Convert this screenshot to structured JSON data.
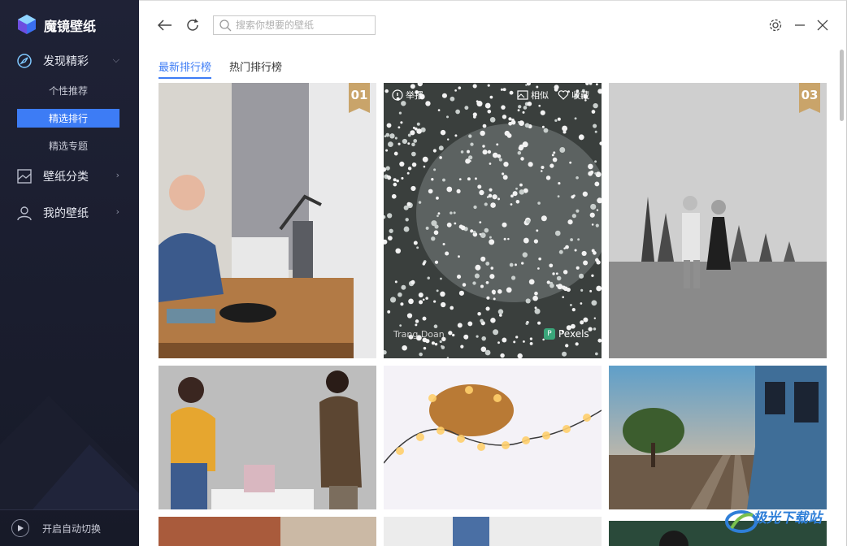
{
  "app": {
    "title": "魔镜壁纸"
  },
  "sidebar": {
    "discover": {
      "label": "发现精彩"
    },
    "sub": {
      "recommend": "个性推荐",
      "ranking": "精选排行",
      "topics": "精选专题"
    },
    "categories": {
      "label": "壁纸分类"
    },
    "mine": {
      "label": "我的壁纸"
    },
    "auto_switch": "开启自动切换"
  },
  "search": {
    "placeholder": "搜索你想要的壁纸"
  },
  "tabs": {
    "latest": "最新排行榜",
    "hot": "热门排行榜"
  },
  "cards": {
    "c1": {
      "rank": "01"
    },
    "c2": {
      "report": "举报",
      "similar": "相似",
      "favorite": "收藏",
      "author": "Trang Doan",
      "source": "Pexels"
    },
    "c3": {
      "rank": "03"
    }
  },
  "watermark": {
    "text": "极光下载站"
  },
  "colors": {
    "accent": "#3d7cf5",
    "rank_badge": "#c9a46a",
    "sidebar_bg": "#1f2236"
  }
}
